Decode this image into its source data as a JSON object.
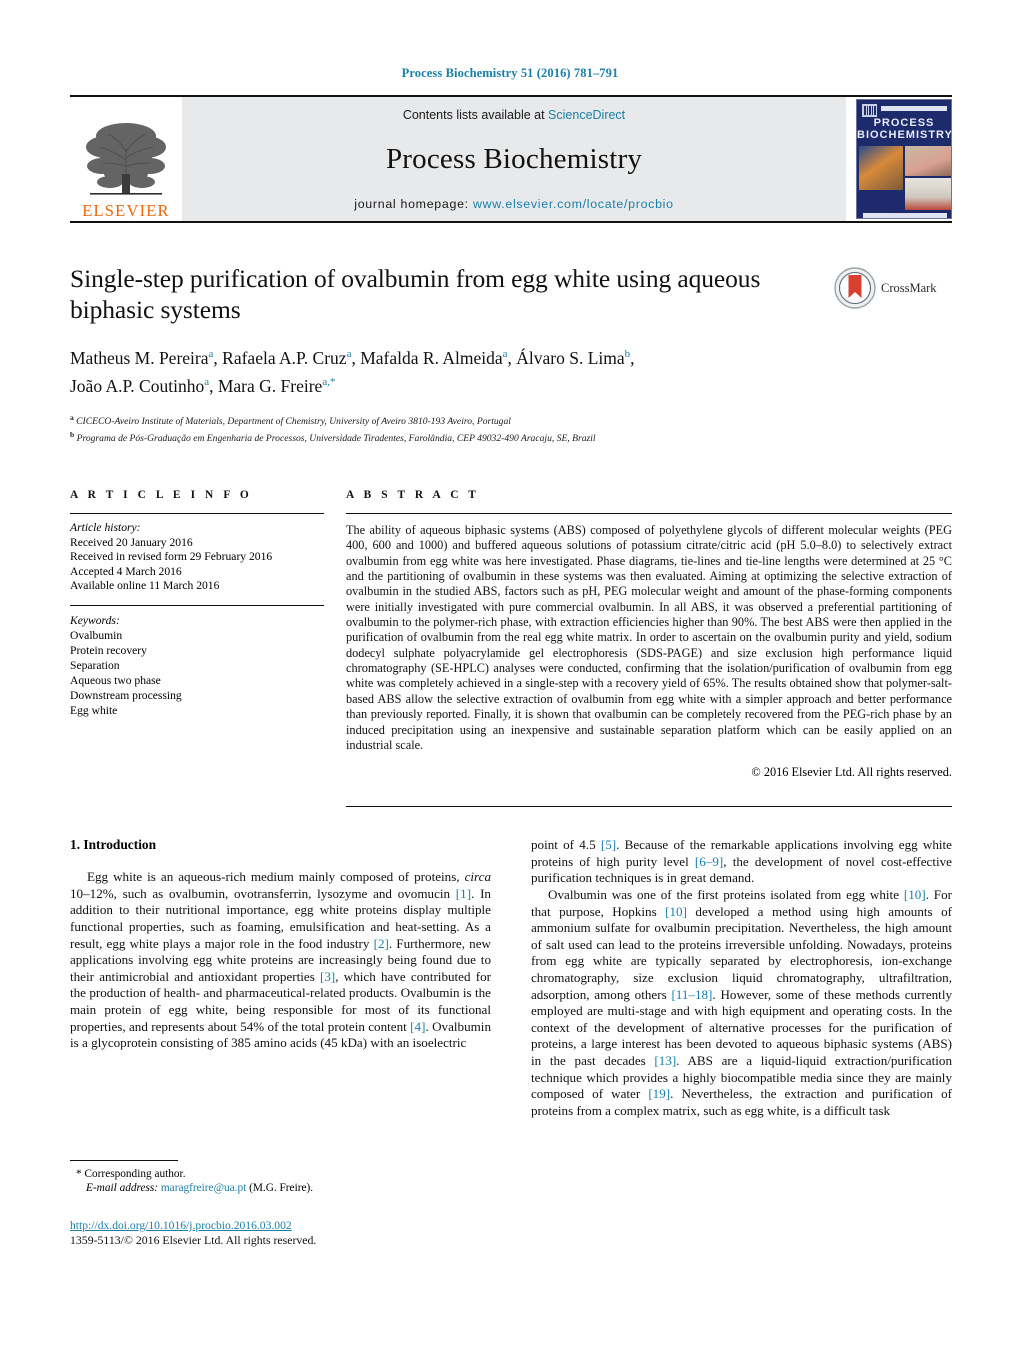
{
  "running_head": "Process Biochemistry 51 (2016) 781–791",
  "masthead": {
    "publisher_name": "ELSEVIER",
    "contents_prefix": "Contents lists available at ",
    "contents_link": "ScienceDirect",
    "journal_title": "Process Biochemistry",
    "homepage_prefix": "journal homepage: ",
    "homepage_url": "www.elsevier.com/locate/procbio",
    "cover_title_line1": "PROCESS",
    "cover_title_line2": "BIOCHEMISTRY"
  },
  "article": {
    "title": "Single-step purification of ovalbumin from egg white using aqueous biphasic systems",
    "crossmark_label": "CrossMark",
    "authors_line1_parts": [
      {
        "name": "Matheus M. Pereira",
        "sup": "a",
        "sep": ", "
      },
      {
        "name": "Rafaela A.P. Cruz",
        "sup": "a",
        "sep": ", "
      },
      {
        "name": "Mafalda R. Almeida",
        "sup": "a",
        "sep": ", "
      },
      {
        "name": "Álvaro S. Lima",
        "sup": "b",
        "sep": ","
      }
    ],
    "authors_line2_parts": [
      {
        "name": "João A.P. Coutinho",
        "sup": "a",
        "sep": ", "
      },
      {
        "name": "Mara G. Freire",
        "sup": "a,*",
        "sep": ""
      }
    ],
    "affiliations": [
      {
        "marker": "a",
        "text": "CICECO-Aveiro Institute of Materials, Department of Chemistry, University of Aveiro 3810-193 Aveiro, Portugal"
      },
      {
        "marker": "b",
        "text": "Programa de Pós-Graduação em Engenharia de Processos, Universidade Tiradentes, Farolândia, CEP 49032-490 Aracaju, SE, Brazil"
      }
    ]
  },
  "article_info": {
    "heading": "A R T I C L E  I N F O",
    "history_label": "Article history:",
    "history": [
      "Received 20 January 2016",
      "Received in revised form 29 February 2016",
      "Accepted 4 March 2016",
      "Available online 11 March 2016"
    ],
    "keywords_label": "Keywords:",
    "keywords": [
      "Ovalbumin",
      "Protein recovery",
      "Separation",
      "Aqueous two phase",
      "Downstream processing",
      "Egg white"
    ]
  },
  "abstract": {
    "heading": "A B S T R A C T",
    "text": "The ability of aqueous biphasic systems (ABS) composed of polyethylene glycols of different molecular weights (PEG 400, 600 and 1000) and buffered aqueous solutions of potassium citrate/citric acid (pH 5.0–8.0) to selectively extract ovalbumin from egg white was here investigated. Phase diagrams, tie-lines and tie-line lengths were determined at 25 °C and the partitioning of ovalbumin in these systems was then evaluated. Aiming at optimizing the selective extraction of ovalbumin in the studied ABS, factors such as pH, PEG molecular weight and amount of the phase-forming components were initially investigated with pure commercial ovalbumin. In all ABS, it was observed a preferential partitioning of ovalbumin to the polymer-rich phase, with extraction efficiencies higher than 90%. The best ABS were then applied in the purification of ovalbumin from the real egg white matrix. In order to ascertain on the ovalbumin purity and yield, sodium dodecyl sulphate polyacrylamide gel electrophoresis (SDS-PAGE) and size exclusion high performance liquid chromatography (SE-HPLC) analyses were conducted, confirming that the isolation/purification of ovalbumin from egg white was completely achieved in a single-step with a recovery yield of 65%. The results obtained show that polymer-salt-based ABS allow the selective extraction of ovalbumin from egg white with a simpler approach and better performance than previously reported. Finally, it is shown that ovalbumin can be completely recovered from the PEG-rich phase by an induced precipitation using an inexpensive and sustainable separation platform which can be easily applied on an industrial scale.",
    "copyright": "© 2016 Elsevier Ltd. All rights reserved."
  },
  "body": {
    "section_heading": "1.  Introduction",
    "left_para1_a": "Egg white is an aqueous-rich medium mainly composed of proteins, ",
    "left_para1_circa": "circa",
    "left_para1_b": " 10–12%, such as ovalbumin, ovotransferrin, lysozyme and ovomucin ",
    "left_ref1": "[1]",
    "left_para1_c": ". In addition to their nutritional importance, egg white proteins display multiple functional properties, such as foaming, emulsification and heat-setting. As a result, egg white plays a major role in the food industry ",
    "left_ref2": "[2]",
    "left_para1_d": ". Furthermore, new applications involving egg white proteins are increasingly being found due to their antimicrobial and antioxidant properties ",
    "left_ref3": "[3]",
    "left_para1_e": ", which have contributed for the production of health- and pharmaceutical-related products. Ovalbumin is the main protein of egg white, being responsible for most of its functional properties, and represents about 54% of the total protein content ",
    "left_ref4": "[4]",
    "left_para1_f": ". Ovalbumin is a glycoprotein consisting of 385 amino acids (45 kDa) with an isoelectric",
    "right_para1_a": "point of 4.5 ",
    "right_ref5": "[5]",
    "right_para1_b": ". Because of the remarkable applications involving egg white proteins of high purity level ",
    "right_ref69": "[6–9]",
    "right_para1_c": ", the development of novel cost-effective purification techniques is in great demand.",
    "right_para2_a": "Ovalbumin was one of the first proteins isolated from egg white ",
    "right_ref10a": "[10]",
    "right_para2_b": ". For that purpose, Hopkins ",
    "right_ref10b": "[10]",
    "right_para2_c": " developed a method using high amounts of ammonium sulfate for ovalbumin precipitation. Nevertheless, the high amount of salt used can lead to the proteins irreversible unfolding. Nowadays, proteins from egg white are typically separated by electrophoresis, ion-exchange chromatography, size exclusion liquid chromatography, ultrafiltration, adsorption, among others ",
    "right_ref1118": "[11–18]",
    "right_para2_d": ". However, some of these methods currently employed are multi-stage and with high equipment and operating costs. In the context of the development of alternative processes for the purification of proteins, a large interest has been devoted to aqueous biphasic systems (ABS) in the past decades ",
    "right_ref13": "[13]",
    "right_para2_e": ". ABS are a liquid-liquid extraction/purification technique which provides a highly biocompatible media since they are mainly composed of water ",
    "right_ref19": "[19]",
    "right_para2_f": ". Nevertheless, the extraction and purification of proteins from a complex matrix, such as egg white, is a difficult task"
  },
  "footer": {
    "corresponding_star": "*",
    "corresponding_text": "Corresponding author.",
    "email_label": "E-mail address:",
    "email": "maragfreire@ua.pt",
    "email_suffix": "(M.G. Freire).",
    "doi": "http://dx.doi.org/10.1016/j.procbio.2016.03.002",
    "issn_line": "1359-5113/© 2016 Elsevier Ltd. All rights reserved."
  },
  "colors": {
    "link": "#1b7fa8",
    "elsevier_orange": "#ec6608",
    "masthead_bg": "#e8e9ea",
    "cover_blue": "#1d2a6b"
  }
}
